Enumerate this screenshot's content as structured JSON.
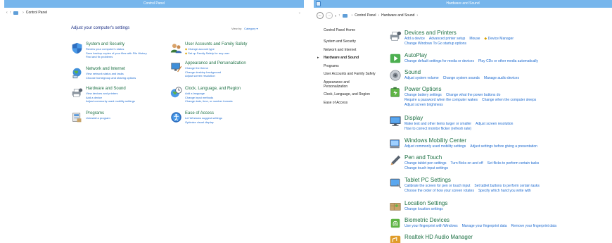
{
  "left_window": {
    "title": "Control Panel",
    "address": {
      "back": "‹",
      "up": "↑",
      "path": [
        "Control Panel"
      ],
      "dropdown": "⌄"
    },
    "heading": "Adjust your computer's settings",
    "view_by_label": "View by:",
    "view_by_value": "Category ▾",
    "categories": [
      {
        "title": "System and Security",
        "links": [
          "Review your computer's status",
          "Save backup copies of your files with File History",
          "Find and fix problems"
        ]
      },
      {
        "title": "Network and Internet",
        "links": [
          "View network status and tasks",
          "Choose homegroup and sharing options"
        ]
      },
      {
        "title": "Hardware and Sound",
        "links": [
          "View devices and printers",
          "Add a device",
          "Adjust commonly used mobility settings"
        ]
      },
      {
        "title": "Programs",
        "links": [
          "Uninstall a program"
        ]
      },
      {
        "title": "User Accounts and Family Safety",
        "links": [
          "Change account type",
          "Set up Family Safety for any user"
        ]
      },
      {
        "title": "Appearance and Personalization",
        "links": [
          "Change the theme",
          "Change desktop background",
          "Adjust screen resolution"
        ]
      },
      {
        "title": "Clock, Language, and Region",
        "links": [
          "Add a language",
          "Change input methods",
          "Change date, time, or number formats"
        ]
      },
      {
        "title": "Ease of Access",
        "links": [
          "Let Windows suggest settings",
          "Optimize visual display"
        ]
      }
    ]
  },
  "right_window": {
    "title": "Hardware and Sound",
    "address": {
      "back": "←",
      "forward": "→",
      "up": "↑",
      "path": [
        "Control Panel",
        "Hardware and Sound"
      ]
    },
    "sidebar": [
      "Control Panel Home",
      "System and Security",
      "Network and Internet",
      "Hardware and Sound",
      "Programs",
      "User Accounts and Family Safety",
      "Appearance and Personalization",
      "Clock, Language, and Region",
      "Ease of Access"
    ],
    "sidebar_active_index": 3,
    "sections": [
      {
        "title": "Devices and Printers",
        "lines": [
          [
            "Add a device",
            "Advanced printer setup",
            "Mouse",
            "Device Manager"
          ],
          [
            "Change Windows To Go startup options"
          ]
        ]
      },
      {
        "title": "AutoPlay",
        "lines": [
          [
            "Change default settings for media or devices",
            "Play CDs or other media automatically"
          ]
        ]
      },
      {
        "title": "Sound",
        "lines": [
          [
            "Adjust system volume",
            "Change system sounds",
            "Manage audio devices"
          ]
        ]
      },
      {
        "title": "Power Options",
        "lines": [
          [
            "Change battery settings",
            "Change what the power buttons do"
          ],
          [
            "Require a password when the computer wakes",
            "Change when the computer sleeps"
          ],
          [
            "Adjust screen brightness"
          ]
        ]
      },
      {
        "title": "Display",
        "lines": [
          [
            "Make text and other items larger or smaller",
            "Adjust screen resolution"
          ],
          [
            "How to correct monitor flicker (refresh rate)"
          ]
        ]
      },
      {
        "title": "Windows Mobility Center",
        "lines": [
          [
            "Adjust commonly used mobility settings",
            "Adjust settings before giving a presentation"
          ]
        ]
      },
      {
        "title": "Pen and Touch",
        "lines": [
          [
            "Change tablet pen settings",
            "Turn flicks on and off",
            "Set flicks to perform certain tasks"
          ],
          [
            "Change touch input settings"
          ]
        ]
      },
      {
        "title": "Tablet PC Settings",
        "lines": [
          [
            "Calibrate the screen for pen or touch input",
            "Set tablet buttons to perform certain tasks"
          ],
          [
            "Choose the order of how your screen rotates",
            "Specify which hand you write with"
          ]
        ]
      },
      {
        "title": "Location Settings",
        "lines": [
          [
            "Change location settings"
          ]
        ]
      },
      {
        "title": "Biometric Devices",
        "lines": [
          [
            "Use your fingerprint with Windows",
            "Manage your fingerprint data",
            "Remove your fingerprint data"
          ]
        ]
      },
      {
        "title": "Realtek HD Audio Manager",
        "lines": []
      }
    ]
  },
  "colors": {
    "titlebar": "#77b6ec",
    "category_title": "#1e7145",
    "link": "#1e6bd0",
    "heading": "#1e3287"
  }
}
